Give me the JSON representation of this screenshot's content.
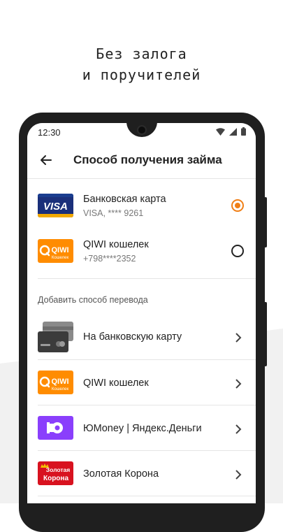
{
  "promo": {
    "line1": "Без залога",
    "line2": "и поручителей"
  },
  "status_bar": {
    "time": "12:30"
  },
  "app_bar": {
    "title": "Способ получения займа",
    "back_icon": "arrow-left-icon"
  },
  "saved_methods": [
    {
      "title": "Банковская карта",
      "subtitle": "VISA, **** 9261",
      "logo_text": "VISA",
      "selected": true
    },
    {
      "title": "QIWI кошелек",
      "subtitle": "+798****2352",
      "logo_text": "QIWI",
      "logo_subtext": "Кошелек",
      "selected": false
    }
  ],
  "add_section": {
    "label": "Добавить способ перевода",
    "items": [
      {
        "title": "На банковскую карту",
        "icon": "bank-cards-icon"
      },
      {
        "title": "QIWI кошелек",
        "icon": "qiwi-logo",
        "logo_text": "QIWI",
        "logo_subtext": "Кошелек"
      },
      {
        "title": "ЮMoney | Яндекс.Деньги",
        "icon": "yoomoney-logo"
      },
      {
        "title": "Золотая Корона",
        "icon": "zolotaya-korona-logo",
        "logo_text_line1": "Золотая",
        "logo_text_line2": "Корона"
      }
    ]
  },
  "colors": {
    "accent": "#f07f16",
    "visa": "#1a2f7a",
    "qiwi": "#ff8c00",
    "yoomoney": "#8a3ffc",
    "korona": "#d8121f"
  }
}
